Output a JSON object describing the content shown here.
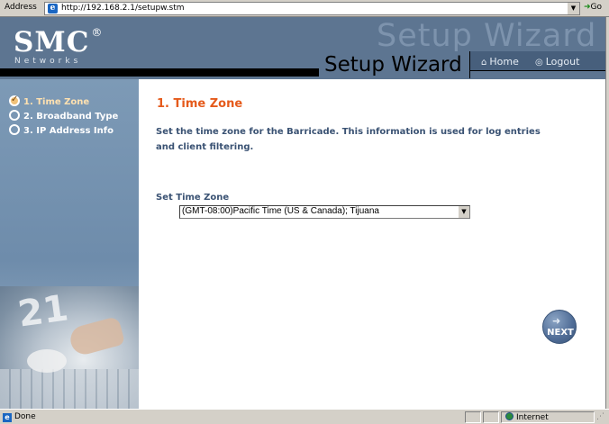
{
  "browser": {
    "address_label": "Address",
    "url": "http://192.168.2.1/setupw.stm",
    "go_label": "Go",
    "status_text": "Done",
    "zone_text": "Internet"
  },
  "header": {
    "logo_text": "SMC",
    "logo_reg": "®",
    "logo_sub": "Networks",
    "watermark": "Setup Wizard",
    "title": "Setup Wizard",
    "nav": {
      "home_label": "Home",
      "logout_label": "Logout"
    }
  },
  "sidebar": {
    "steps": [
      {
        "label": "1. Time Zone",
        "checked": true
      },
      {
        "label": "2. Broadband Type",
        "checked": false
      },
      {
        "label": "3. IP Address Info",
        "checked": false
      }
    ],
    "photo_number": "21"
  },
  "main": {
    "title": "1. Time Zone",
    "description": "Set the time zone for the Barricade. This information is used for log entries and client filtering.",
    "timezone_label": "Set Time Zone",
    "timezone_value": "(GMT-08:00)Pacific Time (US & Canada); Tijuana",
    "next_label": "NEXT"
  },
  "colors": {
    "header_bg": "#5d7591",
    "accent_title": "#e55a1b",
    "body_text": "#3a5273"
  }
}
